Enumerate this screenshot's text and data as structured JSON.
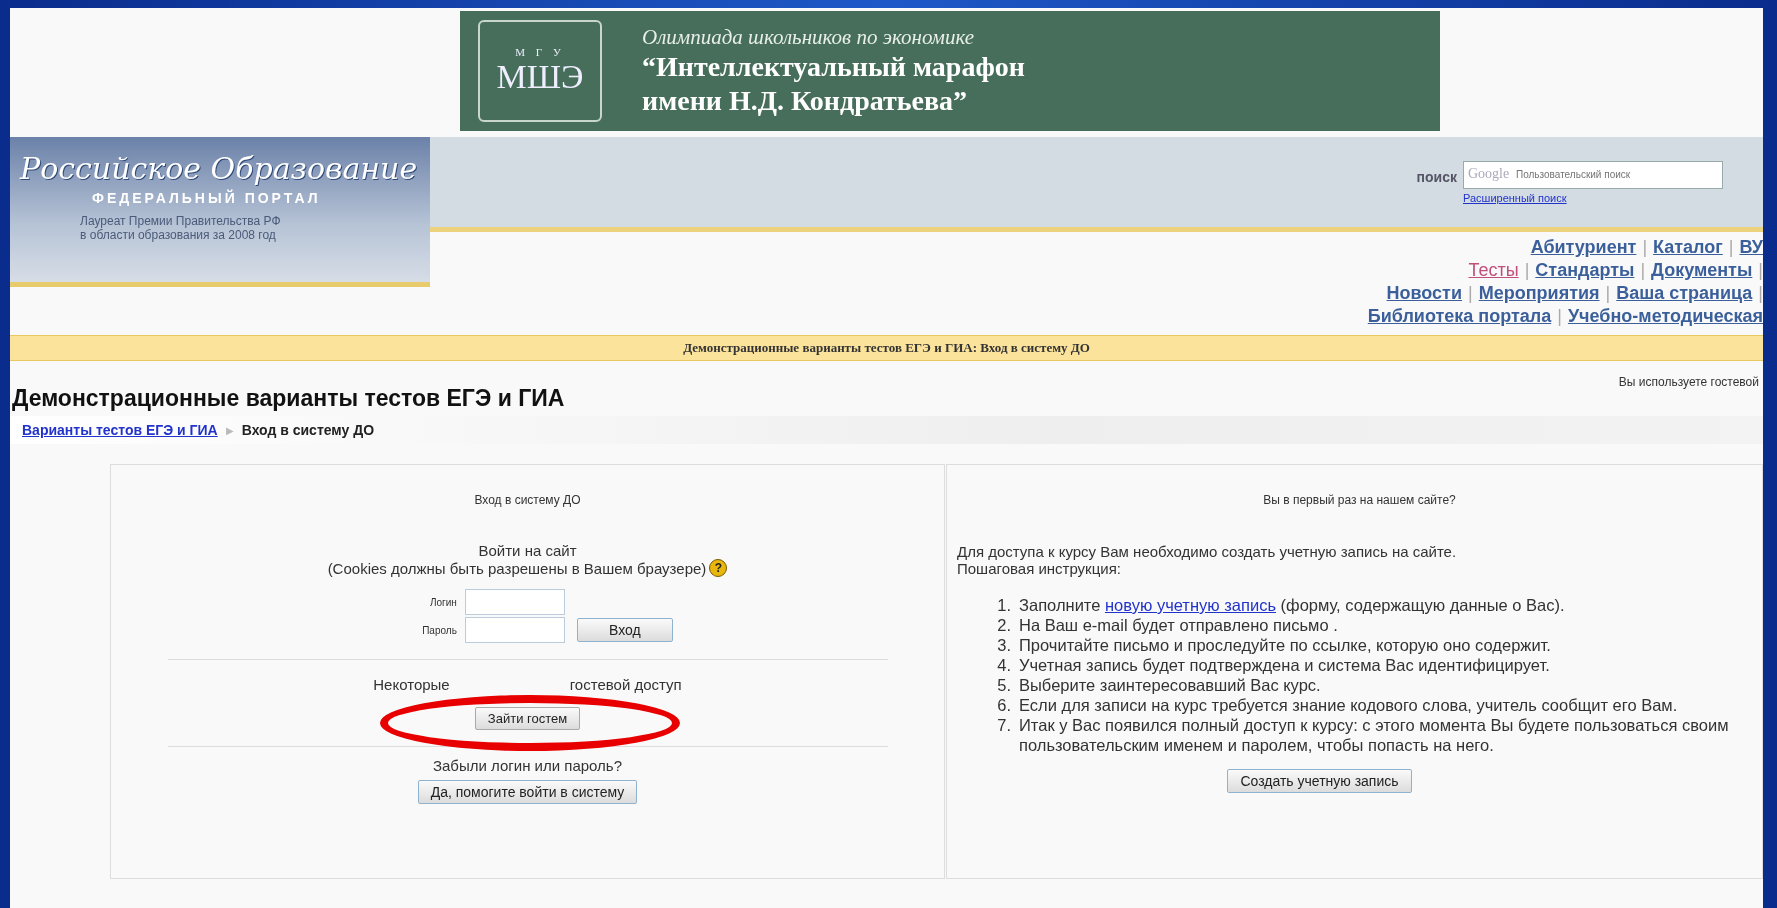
{
  "banner": {
    "logo_top": "М Г У",
    "logo_main": "МШЭ",
    "subtitle": "Олимпиада школьников по экономике",
    "title_lines": [
      "“Интеллектуальный марафон",
      "имени Н.Д. Кондратьева”"
    ]
  },
  "portal": {
    "logo_script": "Российское Образование",
    "logo_caption": "ФЕДЕРАЛЬНЫЙ ПОРТАЛ",
    "award_lines": [
      "Лауреат Премии Правительства РФ",
      "в области образования за 2008 год"
    ]
  },
  "search": {
    "label": "поиск",
    "brand": "Google",
    "placeholder": "Пользовательский поиск",
    "advanced_link": "Расширенный поиск"
  },
  "nav_rows": [
    [
      {
        "kind": "link",
        "label": "Абитуриент",
        "current": false
      },
      {
        "kind": "sep",
        "label": "|"
      },
      {
        "kind": "link",
        "label": "Каталог",
        "current": false
      },
      {
        "kind": "sep",
        "label": "|"
      },
      {
        "kind": "link",
        "label": "ВУ",
        "current": false
      }
    ],
    [
      {
        "kind": "link",
        "label": "Тесты",
        "current": true
      },
      {
        "kind": "sep",
        "label": "|"
      },
      {
        "kind": "link",
        "label": "Стандарты",
        "current": false
      },
      {
        "kind": "sep",
        "label": "|"
      },
      {
        "kind": "link",
        "label": "Документы",
        "current": false
      },
      {
        "kind": "sep",
        "label": "|"
      }
    ],
    [
      {
        "kind": "link",
        "label": "Новости",
        "current": false
      },
      {
        "kind": "sep",
        "label": "|"
      },
      {
        "kind": "link",
        "label": "Мероприятия",
        "current": false
      },
      {
        "kind": "sep",
        "label": "|"
      },
      {
        "kind": "link",
        "label": "Ваша страница",
        "current": false
      },
      {
        "kind": "sep",
        "label": "|"
      }
    ],
    [
      {
        "kind": "link",
        "label": "Библиотека портала",
        "current": false
      },
      {
        "kind": "sep",
        "label": "|"
      },
      {
        "kind": "link",
        "label": "Учебно-методическая",
        "current": false
      }
    ]
  ],
  "notice_bar": "Демонстрационные варианты тестов ЕГЭ и ГИА: Вход в систему ДО",
  "page_title": "Демонстрационные варианты тестов ЕГЭ и ГИА",
  "guest_status": "Вы используете гостевой",
  "breadcrumb": {
    "link": "Варианты тестов ЕГЭ и ГИА",
    "arrow": "▶",
    "current": "Вход в систему ДО"
  },
  "login": {
    "heading": "Вход в систему ДО",
    "intro": "Войти на сайт",
    "cookies_note": "(Cookies должны быть разрешены в Вашем браузере)",
    "help": "?",
    "username_label": "Логин",
    "password_label": "Пароль",
    "submit": "Вход",
    "guest_note_parts": [
      "Некоторые",
      "гостевой доступ"
    ],
    "guest_button": "Зайти гостем",
    "forgot": "Забыли логин или пароль?",
    "forgot_button": "Да, помогите войти в систему"
  },
  "signup": {
    "heading": "Вы в первый раз на нашем сайте?",
    "intro_lines": [
      "Для доступа к курсу Вам необходимо создать учетную запись на сайте.",
      "Пошаговая инструкция:"
    ],
    "steps": [
      {
        "kind": "link",
        "number": "1.",
        "before": "Заполните ",
        "link": "новую учетную запись",
        "after": " (форму, содержащую данные о Вас)."
      },
      {
        "kind": "text",
        "number": "2.",
        "text": "На Ваш e-mail будет отправлено письмо ."
      },
      {
        "kind": "text",
        "number": "3.",
        "text": "Прочитайте письмо и проследуйте по ссылке, которую оно содержит."
      },
      {
        "kind": "text",
        "number": "4.",
        "text": "Учетная запись будет подтверждена и система Вас идентифицирует."
      },
      {
        "kind": "text",
        "number": "5.",
        "text": "Выберите заинтересовавший Вас курс."
      },
      {
        "kind": "text",
        "number": "6.",
        "text": "Если для записи на курс требуется знание кодового слова, учитель сообщит его Вам."
      },
      {
        "kind": "text",
        "number": "7.",
        "text": "Итак у Вас появился полный доступ к курсу: с этого момента Вы будете пользоваться своим пользовательским именем и паролем, чтобы попасть на него."
      }
    ],
    "button": "Создать учетную запись"
  }
}
